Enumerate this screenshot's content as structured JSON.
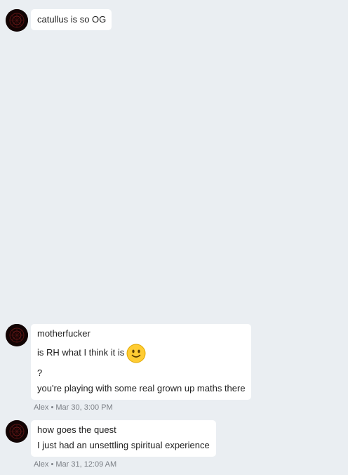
{
  "colors": {
    "background": "#eaeef2",
    "bubble": "#ffffff",
    "text": "#1f1f1f",
    "meta": "#7b7f85",
    "avatar": "#2a0808"
  },
  "messages": [
    {
      "lines": [
        "catullus is so OG"
      ]
    },
    {
      "lines": [
        "motherfucker",
        "is RH what I think it is",
        "?",
        "you're playing with some real grown up maths there"
      ],
      "emoji": "slightly-smiling-face",
      "meta": "Alex • Mar 30, 3:00 PM"
    },
    {
      "lines": [
        "how goes the quest",
        "I just had an unsettling spiritual experience"
      ],
      "meta": "Alex • Mar 31, 12:09 AM"
    }
  ]
}
